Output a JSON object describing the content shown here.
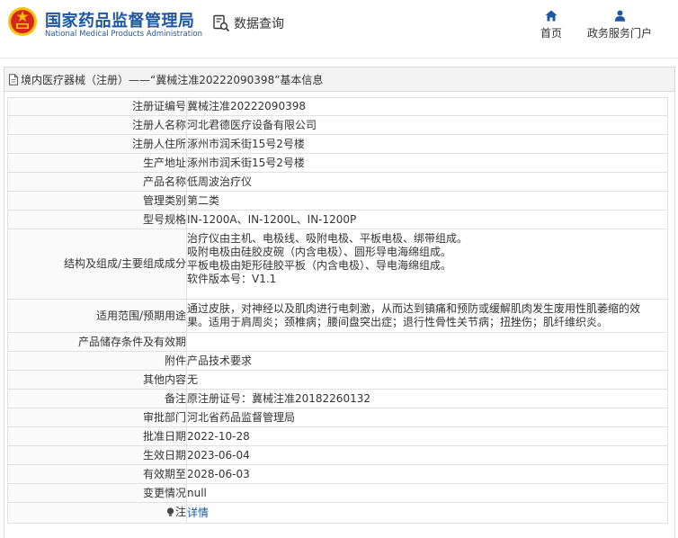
{
  "header": {
    "site_name_cn": "国家药品监督管理局",
    "site_name_en": "National Medical Products Administration",
    "data_query_label": "数据查询",
    "nav": {
      "home": "首页",
      "portal": "政务服务门户"
    }
  },
  "breadcrumb": "境内医疗器械（注册）——“冀械注准20222090398”基本信息",
  "rows": [
    {
      "label": "注册证编号",
      "value": "冀械注准20222090398"
    },
    {
      "label": "注册人名称",
      "value": "河北君德医疗设备有限公司"
    },
    {
      "label": "注册人住所",
      "value": "涿州市润禾街15号2号楼"
    },
    {
      "label": "生产地址",
      "value": "涿州市润禾街15号2号楼"
    },
    {
      "label": "产品名称",
      "value": "低周波治疗仪"
    },
    {
      "label": "管理类别",
      "value": "第二类"
    },
    {
      "label": "型号规格",
      "value": "IN-1200A、IN-1200L、IN-1200P"
    },
    {
      "label": "结构及组成/主要组成成分",
      "lines": [
        "治疗仪由主机、电极线、吸附电极、平板电极、绑带组成。",
        "吸附电极由硅胶皮碗（内含电极）、圆形导电海绵组成。",
        "平板电极由矩形硅胶平板（内含电极）、导电海绵组成。",
        "软件版本号：V1.1"
      ]
    },
    {
      "label": "适用范围/预期用途",
      "lines": [
        "通过皮肤，对神经以及肌肉进行电刺激，从而达到镇痛和预防或缓解肌肉发生废用性肌萎缩的效",
        "果。适用于肩周炎；颈椎病；腰间盘突出症；退行性骨性关节病；扭挫伤；肌纤维织炎。"
      ]
    },
    {
      "label": "产品储存条件及有效期",
      "value": ""
    },
    {
      "label": "附件",
      "value": "产品技术要求"
    },
    {
      "label": "其他内容",
      "value": "无"
    },
    {
      "label": "备注",
      "value": "原注册证号：冀械注准20182260132"
    },
    {
      "label": "审批部门",
      "value": "河北省药品监督管理局"
    },
    {
      "label": "批准日期",
      "value": "2022-10-28"
    },
    {
      "label": "生效日期",
      "value": "2023-06-04"
    },
    {
      "label": "有效期至",
      "value": "2028-06-03"
    },
    {
      "label": "变更情况",
      "value": "null"
    }
  ],
  "note_row": {
    "label": "注",
    "link": "详情"
  },
  "colors": {
    "brand_blue": "#1f56a3",
    "emblem_red": "#d7261e",
    "emblem_gold": "#f4c20d"
  },
  "icons": {
    "emblem": "national-emblem-icon",
    "query": "document-search-icon",
    "home": "home-icon",
    "portal": "person-icon",
    "breadcrumb": "document-icon",
    "note": "lightbulb-icon"
  }
}
